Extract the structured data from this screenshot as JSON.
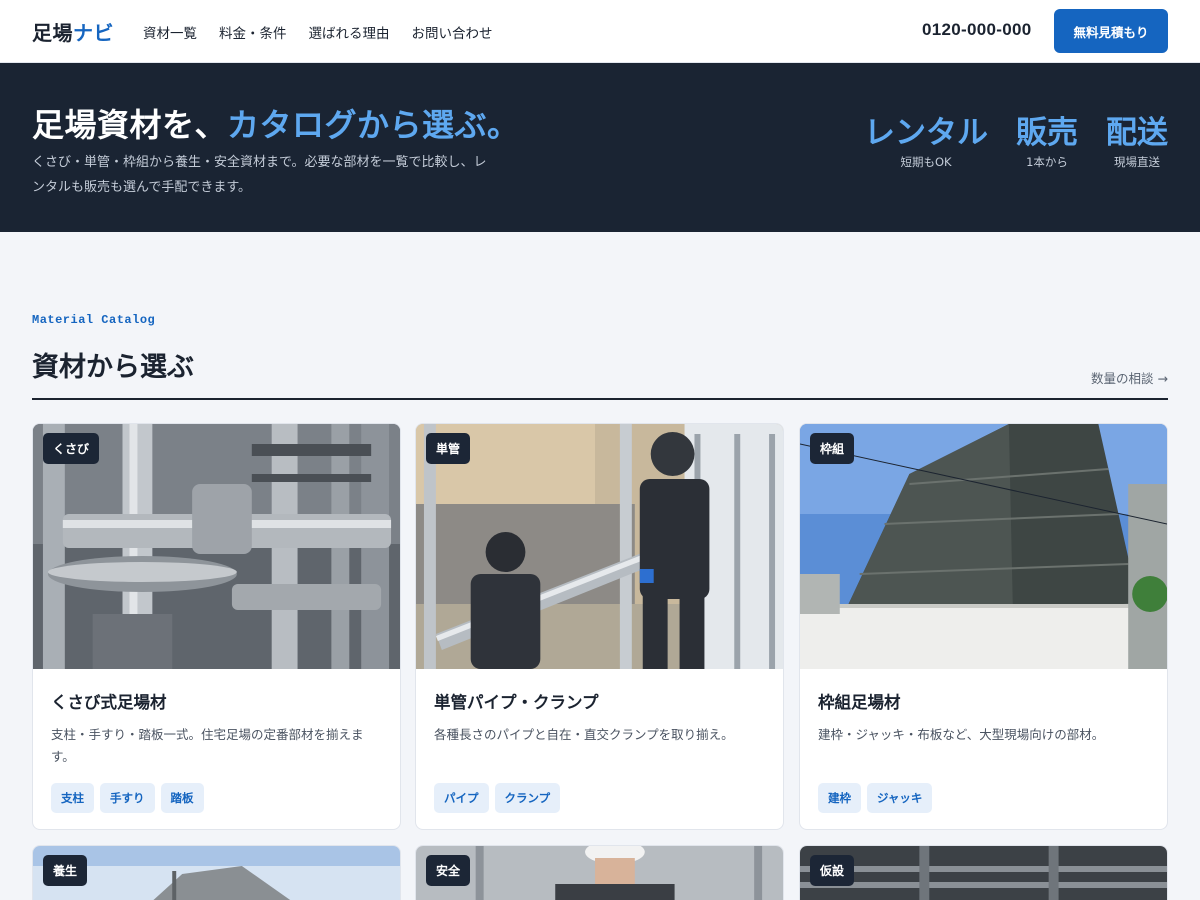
{
  "header": {
    "logo_main": "足場",
    "logo_accent": "ナビ",
    "nav": [
      "資材一覧",
      "料金・条件",
      "選ばれる理由",
      "お問い合わせ"
    ],
    "phone": "0120-000-000",
    "cta": "無料見積もり"
  },
  "hero": {
    "title_main": "足場資材を、",
    "title_highlight": "カタログから選ぶ。",
    "description": "くさび・単管・枠組から養生・安全資材まで。必要な部材を一覧で比較し、レンタルも販売も選んで手配できます。",
    "stats": [
      {
        "value": "レンタル",
        "label": "短期もOK"
      },
      {
        "value": "販売",
        "label": "1本から"
      },
      {
        "value": "配送",
        "label": "現場直送"
      }
    ]
  },
  "section": {
    "eyebrow": "Material Catalog",
    "title": "資材から選ぶ",
    "link": "数量の相談 →"
  },
  "cards": [
    {
      "badge": "くさび",
      "title": "くさび式足場材",
      "description": "支柱・手すり・踏板一式。住宅足場の定番部材を揃えます。",
      "tags": [
        "支柱",
        "手すり",
        "踏板"
      ]
    },
    {
      "badge": "単管",
      "title": "単管パイプ・クランプ",
      "description": "各種長さのパイプと自在・直交クランプを取り揃え。",
      "tags": [
        "パイプ",
        "クランプ"
      ]
    },
    {
      "badge": "枠組",
      "title": "枠組足場材",
      "description": "建枠・ジャッキ・布板など、大型現場向けの部材。",
      "tags": [
        "建枠",
        "ジャッキ"
      ]
    },
    {
      "badge": "養生"
    },
    {
      "badge": "安全"
    },
    {
      "badge": "仮設"
    }
  ],
  "colors": {
    "accent": "#1565c0",
    "hero_bg": "#1a2433",
    "hero_highlight": "#5ea8f0",
    "page_bg": "#f3f5f9"
  }
}
